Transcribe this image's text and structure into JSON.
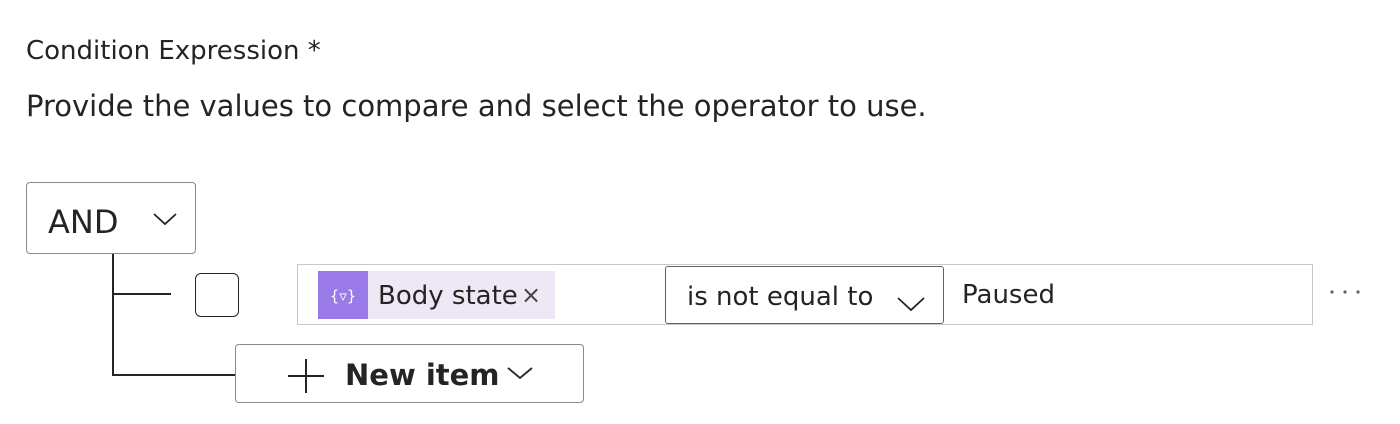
{
  "condition": {
    "label": "Condition Expression *",
    "description": "Provide the values to compare and select the operator to use.",
    "group_operator": "AND",
    "rows": [
      {
        "left_token": {
          "label": "Body state",
          "close_glyph": "×",
          "icon": "expression-icon",
          "icon_glyph": "{▿}"
        },
        "operator": "is not equal to",
        "value": "Paused",
        "more_glyph": "···"
      }
    ],
    "new_item_label": "New item"
  },
  "colors": {
    "token_background": "#ede7f6",
    "token_icon_background": "#9a7ae6",
    "text": "#242424",
    "border": "#8a8a8a"
  }
}
